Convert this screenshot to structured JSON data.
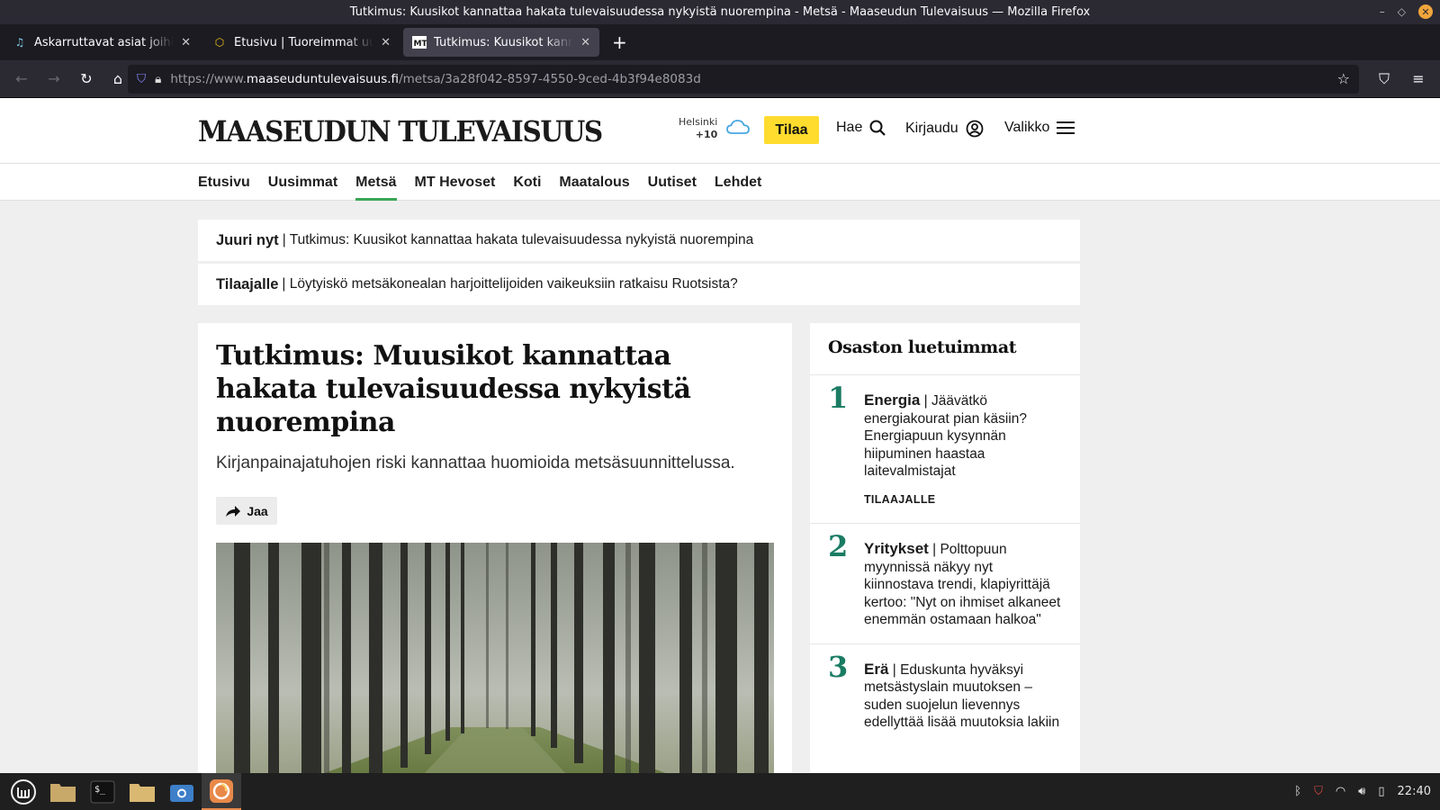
{
  "window": {
    "title": "Tutkimus: Kuusikot kannattaa hakata tulevaisuudessa nykyistä nuorempina - Metsä - Maaseudun Tulevaisuus — Mozilla Firefox"
  },
  "tabs": [
    {
      "label": "Askarruttavat asiat joihin et",
      "icon": "music-note-icon"
    },
    {
      "label": "Etusivu | Tuoreimmat uutise",
      "icon": "hexagon-icon"
    },
    {
      "label": "Tutkimus: Kuusikot kannatt",
      "icon": "mt-favicon"
    }
  ],
  "url": {
    "prefix": "https://www.",
    "host": "maaseuduntulevaisuus.fi",
    "path": "/metsa/3a28f042-8597-4550-9ced-4b3f94e8083d"
  },
  "site": {
    "logo": "MAASEUDUN TULEVAISUUS",
    "weather_city": "Helsinki",
    "weather_temp": "+10",
    "subscribe": "Tilaa",
    "search": "Hae",
    "login": "Kirjaudu",
    "menu": "Valikko"
  },
  "nav": [
    "Etusivu",
    "Uusimmat",
    "Metsä",
    "MT Hevoset",
    "Koti",
    "Maatalous",
    "Uutiset",
    "Lehdet"
  ],
  "ticker": [
    {
      "label": "Juuri nyt",
      "text": "| Tutkimus: Kuusikot kannattaa hakata tulevaisuudessa nykyistä nuorempina"
    },
    {
      "label": "Tilaajalle",
      "text": "| Löytyiskö metsäkonealan harjoittelijoiden vaikeuksiin ratkaisu Ruotsista?"
    }
  ],
  "article": {
    "headline": "Tutkimus: Muusikot kannattaa hakata tulevaisuudessa nykyistä nuorempina",
    "lead": "Kirjanpainajatuhojen riski kannattaa huomioida metsäsuunnittelussa.",
    "share": "Jaa"
  },
  "sidebar": {
    "title": "Osaston luetuimmat",
    "items": [
      {
        "num": "1",
        "category": "Energia",
        "text": "| Jäävätkö energiakourat pian käsiin? Energiapuun kysynnän hiipuminen haastaa laitevalmistajat",
        "tag": "TILAAJALLE"
      },
      {
        "num": "2",
        "category": "Yritykset",
        "text": "| Polttopuun myynnissä näkyy nyt kiinnostava trendi, klapiyrittäjä kertoo: \"Nyt on ihmiset alkaneet enemmän ostamaan halkoa\"",
        "tag": ""
      },
      {
        "num": "3",
        "category": "Erä",
        "text": "| Eduskunta hyväksyi metsästyslain muutoksen – suden suojelun lievennys edellyttää lisää muutoksia lakiin",
        "tag": ""
      }
    ]
  },
  "taskbar": {
    "clock": "22:40"
  }
}
